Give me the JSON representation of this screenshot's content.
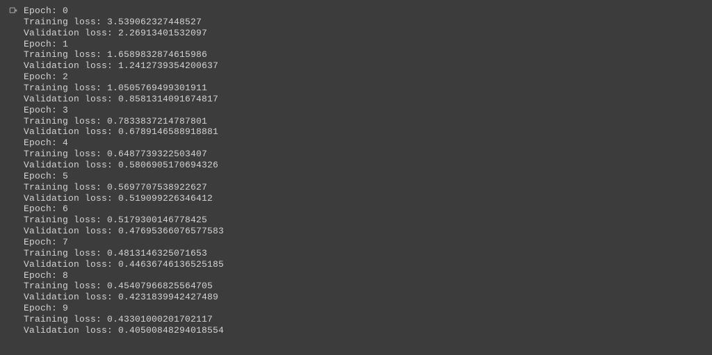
{
  "epochs": [
    {
      "epoch": 0,
      "training_loss": "3.539062327448527",
      "validation_loss": "2.26913401532097"
    },
    {
      "epoch": 1,
      "training_loss": "1.6589832874615986",
      "validation_loss": "1.2412739354200637"
    },
    {
      "epoch": 2,
      "training_loss": "1.0505769499301911",
      "validation_loss": "0.8581314091674817"
    },
    {
      "epoch": 3,
      "training_loss": "0.7833837214787801",
      "validation_loss": "0.6789146588918881"
    },
    {
      "epoch": 4,
      "training_loss": "0.6487739322503407",
      "validation_loss": "0.5806905170694326"
    },
    {
      "epoch": 5,
      "training_loss": "0.5697707538922627",
      "validation_loss": "0.519099226346412"
    },
    {
      "epoch": 6,
      "training_loss": "0.5179300146778425",
      "validation_loss": "0.47695366076577583"
    },
    {
      "epoch": 7,
      "training_loss": "0.4813146325071653",
      "validation_loss": "0.44636746136525185"
    },
    {
      "epoch": 8,
      "training_loss": "0.45407966825564705",
      "validation_loss": "0.4231839942427489"
    },
    {
      "epoch": 9,
      "training_loss": "0.43301000201702117",
      "validation_loss": "0.40500848294018554"
    }
  ],
  "labels": {
    "epoch_prefix": "Epoch: ",
    "training_prefix": "Training loss: ",
    "validation_prefix": "Validation loss: "
  }
}
